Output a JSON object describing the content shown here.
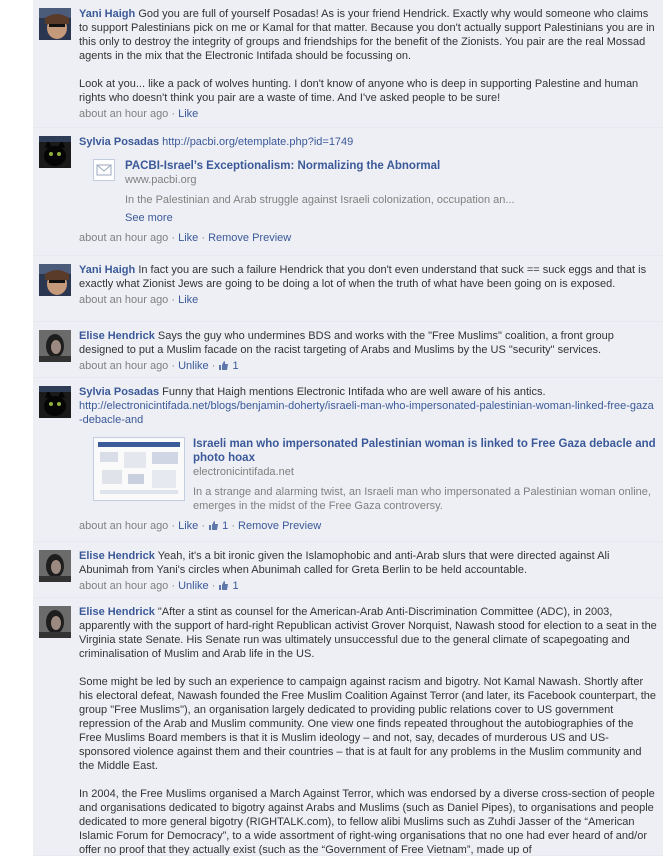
{
  "comments": [
    {
      "author": "Yani Haigh",
      "paragraphs": [
        "God you are full of yourself Posadas! As is your friend Hendrick. Exactly why would someone who claims to support Palestinians pick on me or Kamal for that matter. Because you don't actually support Palestinians you are in this only to destroy the integrity of groups and friendships for the benefit of the Zionists. You pair are the real Mossad agents in the mix that the Electronic Intifada should be focussing on.",
        "Look at you... like a pack of wolves hunting. I don't know of anyone who is deep in supporting Palestine and human rights who doesn't think you pair are a waste of time. And I've asked people to be sure!"
      ],
      "time": "about an hour ago",
      "actions": [
        "Like"
      ]
    },
    {
      "author": "Sylvia Posadas",
      "link": "http://pacbi.org/etemplate.php?id=1749",
      "share": {
        "title": "PACBI-Israel’s Exceptionalism: Normalizing the Abnormal",
        "domain": "www.pacbi.org",
        "desc": "In the Palestinian and Arab struggle against Israeli colonization, occupation an...",
        "see_more": "See more"
      },
      "time": "about an hour ago",
      "actions": [
        "Like",
        "Remove Preview"
      ]
    },
    {
      "author": "Yani Haigh",
      "paragraphs": [
        "In fact you are such a failure Hendrick that you don't even understand that suck == suck eggs and that is exactly what Zionist Jews are going to be doing a lot of when the truth of what have been going on is exposed."
      ],
      "time": "about an hour ago",
      "actions": [
        "Like"
      ]
    },
    {
      "author": "Elise Hendrick",
      "paragraphs": [
        "Says the guy who undermines BDS and works with the \"Free Muslims\" coalition, a front group designed to put a Muslim facade on the racist targeting of Arabs and Muslims by the US \"security\" services."
      ],
      "time": "about an hour ago",
      "actions": [
        "Unlike"
      ],
      "likes": "1"
    },
    {
      "author": "Sylvia Posadas",
      "paragraphs": [
        "Funny that Haigh mentions Electronic Intifada who are well aware of his antics."
      ],
      "link": "http://electronicintifada.net/blogs/benjamin-doherty/israeli-man-who-impersonated-palestinian-woman-linked-free-gaza-debacle-and",
      "share": {
        "title": "Israeli man who impersonated Palestinian woman is linked to Free Gaza debacle and photo hoax",
        "domain": "electronicintifada.net",
        "desc": "In a strange and alarming twist, an Israeli man who impersonated a Palestinian woman online, emerges in the midst of the Free Gaza controversy."
      },
      "time": "about an hour ago",
      "actions": [
        "Like"
      ],
      "likes": "1",
      "extra_action": "Remove Preview"
    },
    {
      "author": "Elise Hendrick",
      "paragraphs": [
        "Yeah, it's a bit ironic given the Islamophobic and anti-Arab slurs that were directed against Ali Abunimah from Yani's circles when Abunimah called for Greta Berlin to be held accountable."
      ],
      "time": "about an hour ago",
      "actions": [
        "Unlike"
      ],
      "likes": "1"
    },
    {
      "author": "Elise Hendrick",
      "paragraphs": [
        "\"After a stint as counsel for the American-Arab Anti-Discrimination Committee (ADC), in 2003, apparently with the support of hard-right Republican activist Grover Norquist, Nawash stood for election to a seat in the Virginia state Senate. His Senate run was ultimately unsuccessful due to the general climate of scapegoating and criminalisation of Muslim and Arab life in the US.",
        "Some might be led by such an experience to campaign against racism and bigotry. Not Kamal Nawash. Shortly after his electoral defeat, Nawash founded the Free Muslim Coalition Against Terror (and later, its Facebook counterpart, the group \"Free Muslims\"), an organisation largely dedicated to providing public relations cover to US government repression of the Arab and Muslim community. One view one finds repeated throughout the autobiographies of the Free Muslims Board members is that it is Muslim ideology – and not, say, decades of murderous US and US-sponsored violence against them and their countries – that is at fault for any problems in the Muslim community and the Middle East.",
        "In 2004, the Free Muslims organised a March Against Terror, which was endorsed by a diverse cross-section of people and organisations dedicated to bigotry against Arabs and Muslims (such as Daniel Pipes), to organisations and people dedicated to more general bigotry (RIGHTALK.com), to fellow alibi Muslims such as Zuhdi Jasser of the “American Islamic Forum for Democracy”, to a wide assortment of right-wing organisations that no one had ever heard of and/or offer no proof that they actually exist (such as the “Government of Free Vietnam”, made up of"
      ]
    }
  ],
  "colors": {
    "link": "#3b5998",
    "panel_bg": "#edeff4",
    "meta": "#808080"
  }
}
